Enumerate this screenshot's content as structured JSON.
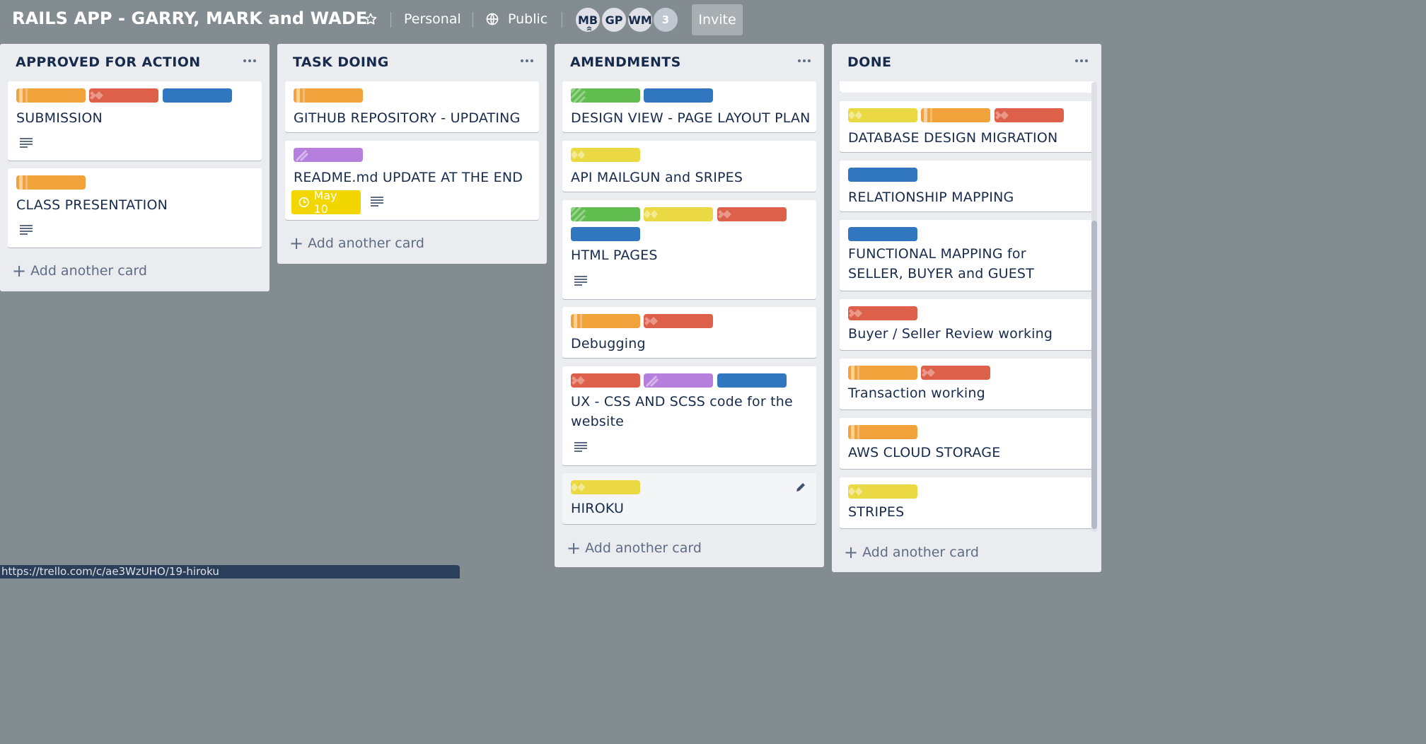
{
  "board": {
    "title": "RAILS APP - GARRY, MARK and WADE",
    "visibility_team": "Personal",
    "visibility": "Public",
    "members": [
      "MB",
      "GP",
      "WM"
    ],
    "member_overflow": "3",
    "invite_label": "Invite"
  },
  "colors": {
    "board_bg": "#838c91",
    "orange": "#f2a23a",
    "red": "#dd614a",
    "blue": "#3177c0",
    "green": "#61bd4f",
    "yellow": "#ead942",
    "purple": "#b67fdd",
    "due_yellow": "#f2d600"
  },
  "add_card_label": "Add another card",
  "lists": [
    {
      "title": "APPROVED FOR ACTION",
      "cards": [
        {
          "title": "SUBMISSION",
          "labels": [
            "orange",
            "red",
            "blue"
          ],
          "has_description": true
        },
        {
          "title": "CLASS PRESENTATION",
          "labels": [
            "orange"
          ],
          "has_description": true
        }
      ]
    },
    {
      "title": "TASK DOING",
      "cards": [
        {
          "title": "GITHUB REPOSITORY - UPDATING",
          "labels": [
            "orange"
          ],
          "has_description": false
        },
        {
          "title": "README.md UPDATE AT THE END",
          "labels": [
            "purple"
          ],
          "has_description": true,
          "due": "May 10"
        }
      ]
    },
    {
      "title": "AMENDMENTS",
      "cards": [
        {
          "title": "DESIGN VIEW - PAGE LAYOUT PLAN",
          "labels": [
            "green",
            "blue"
          ],
          "has_description": false
        },
        {
          "title": "API MAILGUN and SRIPES",
          "labels": [
            "yellow"
          ],
          "has_description": false
        },
        {
          "title": "HTML PAGES",
          "labels": [
            "green",
            "yellow",
            "red",
            "blue"
          ],
          "has_description": true
        },
        {
          "title": "Debugging",
          "labels": [
            "orange",
            "red"
          ],
          "has_description": false
        },
        {
          "title": "UX - CSS AND SCSS code for the website",
          "labels": [
            "red",
            "purple",
            "blue"
          ],
          "has_description": true
        },
        {
          "title": "HIROKU",
          "labels": [
            "yellow"
          ],
          "has_description": false,
          "hovered": true
        }
      ]
    },
    {
      "title": "DONE",
      "cards": [
        {
          "title": "DATABASE DESIGN MIGRATION",
          "labels": [
            "yellow",
            "orange",
            "red"
          ],
          "has_description": false
        },
        {
          "title": "RELATIONSHIP MAPPING",
          "labels": [
            "blue"
          ],
          "has_description": false
        },
        {
          "title": "FUNCTIONAL MAPPING for SELLER, BUYER and GUEST",
          "labels": [
            "blue"
          ],
          "has_description": false
        },
        {
          "title": "Buyer / Seller Review working",
          "labels": [
            "red"
          ],
          "has_description": false
        },
        {
          "title": "Transaction working",
          "labels": [
            "orange",
            "red"
          ],
          "has_description": false
        },
        {
          "title": "AWS CLOUD STORAGE",
          "labels": [
            "orange"
          ],
          "has_description": false
        },
        {
          "title": "STRIPES",
          "labels": [
            "yellow"
          ],
          "has_description": false
        }
      ]
    }
  ],
  "status_bar_url": "https://trello.com/c/ae3WzUHO/19-hiroku"
}
